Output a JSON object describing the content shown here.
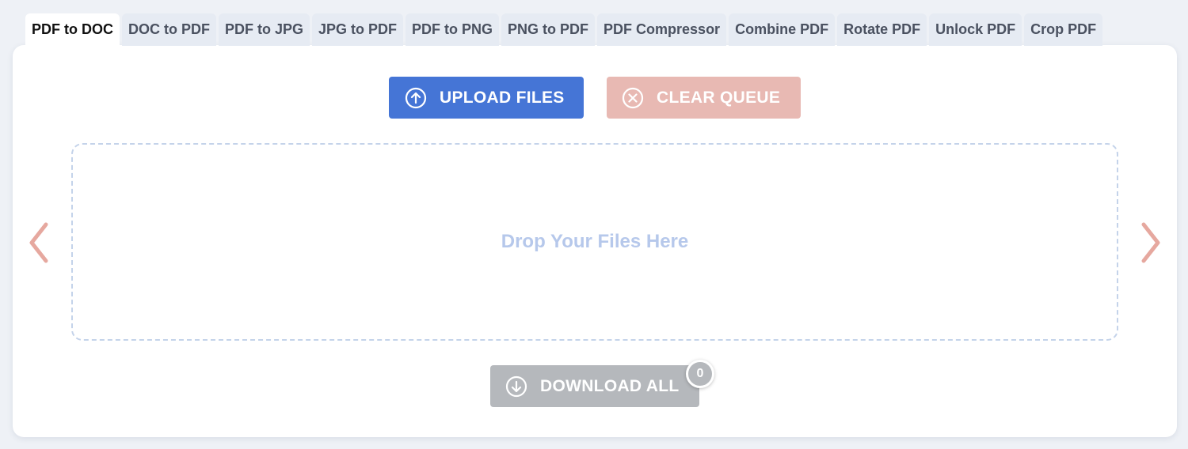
{
  "tabs": [
    {
      "label": "PDF to DOC",
      "active": true
    },
    {
      "label": "DOC to PDF",
      "active": false
    },
    {
      "label": "PDF to JPG",
      "active": false
    },
    {
      "label": "JPG to PDF",
      "active": false
    },
    {
      "label": "PDF to PNG",
      "active": false
    },
    {
      "label": "PNG to PDF",
      "active": false
    },
    {
      "label": "PDF Compressor",
      "active": false
    },
    {
      "label": "Combine PDF",
      "active": false
    },
    {
      "label": "Rotate PDF",
      "active": false
    },
    {
      "label": "Unlock PDF",
      "active": false
    },
    {
      "label": "Crop PDF",
      "active": false
    }
  ],
  "toolbar": {
    "upload_label": "UPLOAD FILES",
    "upload_icon": "upload-circle-icon",
    "clear_label": "CLEAR QUEUE",
    "clear_icon": "close-circle-icon"
  },
  "dropzone": {
    "text": "Drop Your Files Here"
  },
  "download": {
    "label": "DOWNLOAD ALL",
    "icon": "download-circle-icon",
    "count": "0"
  },
  "nav": {
    "prev_icon": "chevron-left-icon",
    "next_icon": "chevron-right-icon"
  },
  "colors": {
    "upload": "#4575d6",
    "clear": "#e8b9b3",
    "download": "#b5b8bc",
    "arrow": "#e6a89f",
    "dropzone_border": "#c4d3ea",
    "dropzone_text": "#b6c8eb"
  }
}
